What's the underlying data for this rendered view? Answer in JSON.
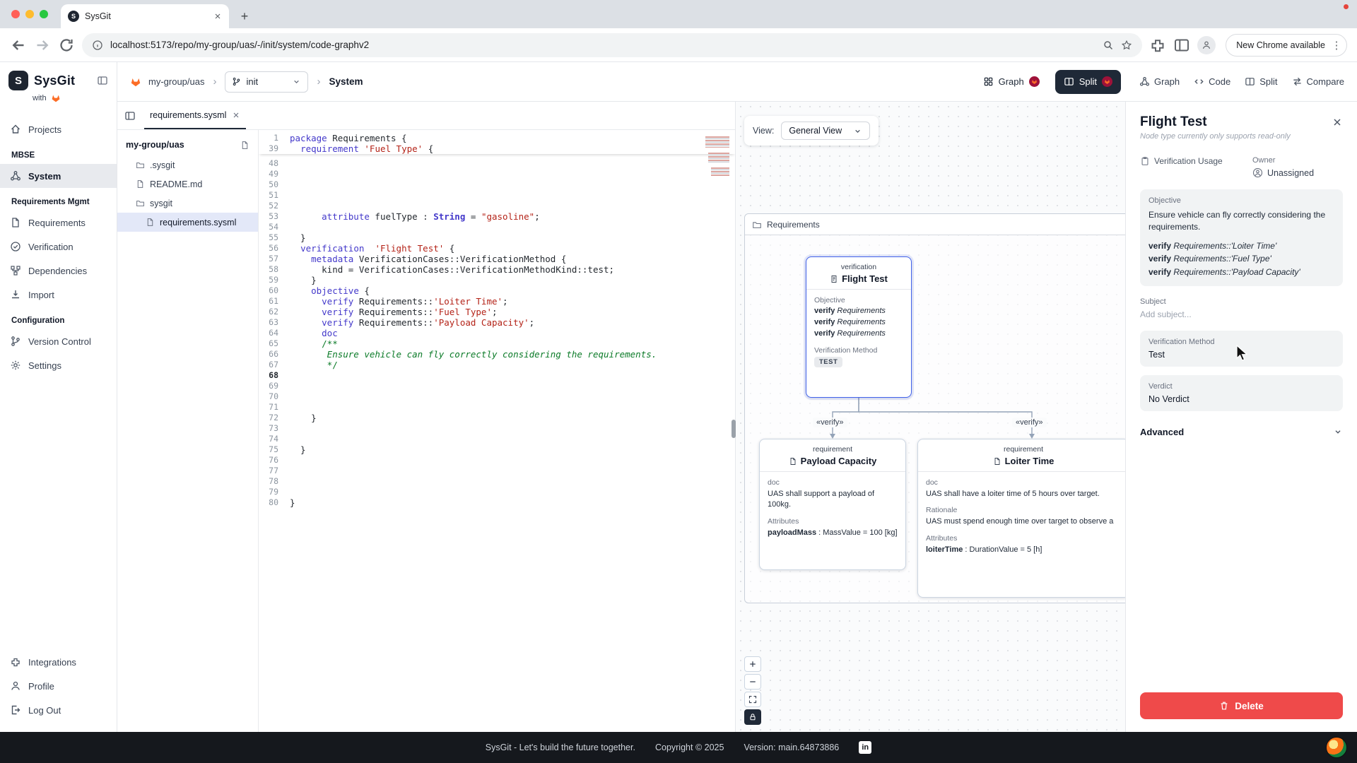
{
  "browser": {
    "tab_title": "SysGit",
    "url": "localhost:5173/repo/my-group/uas/-/init/system/code-graphv2",
    "update_label": "New Chrome available"
  },
  "sidebar": {
    "brand": "SysGit",
    "brand_letter": "S",
    "with_label": "with",
    "groups": [
      {
        "items": [
          {
            "label": "Projects",
            "icon": "home"
          }
        ]
      },
      {
        "header": "MBSE",
        "items": [
          {
            "label": "System",
            "icon": "system",
            "active": true
          }
        ]
      },
      {
        "header": "Requirements Mgmt",
        "items": [
          {
            "label": "Requirements",
            "icon": "doc"
          },
          {
            "label": "Verification",
            "icon": "check"
          },
          {
            "label": "Dependencies",
            "icon": "deps"
          },
          {
            "label": "Import",
            "icon": "import"
          }
        ]
      },
      {
        "header": "Configuration",
        "items": [
          {
            "label": "Version Control",
            "icon": "branch"
          },
          {
            "label": "Settings",
            "icon": "gear"
          }
        ]
      }
    ],
    "bottom": [
      {
        "label": "Integrations",
        "icon": "puzzle"
      },
      {
        "label": "Profile",
        "icon": "person"
      },
      {
        "label": "Log Out",
        "icon": "logout"
      }
    ]
  },
  "header": {
    "repo": "my-group/uas",
    "branch": "init",
    "page": "System",
    "primary_buttons": [
      {
        "label": "Graph",
        "icon": "grid",
        "active": false
      },
      {
        "label": "Split",
        "icon": "splitic",
        "active": true
      }
    ],
    "secondary_buttons": [
      {
        "label": "Graph",
        "icon": "system"
      },
      {
        "label": "Code",
        "icon": "code"
      },
      {
        "label": "Split",
        "icon": "splitic"
      },
      {
        "label": "Compare",
        "icon": "compare"
      }
    ]
  },
  "explorer": {
    "tab_label": "requirements.sysml",
    "root_label": "my-group/uas",
    "items": [
      {
        "label": ".sysgit",
        "icon": "folder",
        "indent": 0
      },
      {
        "label": "README.md",
        "icon": "file",
        "indent": 0
      },
      {
        "label": "sysgit",
        "icon": "folder",
        "indent": 0
      },
      {
        "label": "requirements.sysml",
        "icon": "file",
        "indent": 1,
        "active": true
      }
    ]
  },
  "editor": {
    "sticky": [
      {
        "n": "1",
        "t": [
          [
            "k",
            "package"
          ],
          [
            "d",
            " Requirements {"
          ]
        ]
      },
      {
        "n": "39",
        "t": [
          [
            "d",
            "  "
          ],
          [
            "k",
            "requirement"
          ],
          [
            "d",
            " "
          ],
          [
            "s",
            "'Fuel Type'"
          ],
          [
            "d",
            " {"
          ]
        ]
      }
    ],
    "lines": [
      {
        "n": "48",
        "t": []
      },
      {
        "n": "49",
        "t": []
      },
      {
        "n": "50",
        "t": []
      },
      {
        "n": "51",
        "t": []
      },
      {
        "n": "52",
        "t": []
      },
      {
        "n": "53",
        "t": [
          [
            "d",
            "      "
          ],
          [
            "k",
            "attribute"
          ],
          [
            "d",
            " fuelType : "
          ],
          [
            "t",
            "String"
          ],
          [
            "d",
            " = "
          ],
          [
            "s",
            "\"gasoline\""
          ],
          [
            "d",
            ";"
          ]
        ]
      },
      {
        "n": "54",
        "t": []
      },
      {
        "n": "55",
        "t": [
          [
            "d",
            "  }"
          ]
        ]
      },
      {
        "n": "56",
        "t": [
          [
            "d",
            "  "
          ],
          [
            "k",
            "verification"
          ],
          [
            "d",
            "  "
          ],
          [
            "s",
            "'Flight Test'"
          ],
          [
            "d",
            " {"
          ]
        ]
      },
      {
        "n": "57",
        "t": [
          [
            "d",
            "    "
          ],
          [
            "k",
            "metadata"
          ],
          [
            "d",
            " VerificationCases::VerificationMethod {"
          ]
        ]
      },
      {
        "n": "58",
        "t": [
          [
            "d",
            "      kind = VerificationCases::VerificationMethodKind::test;"
          ]
        ]
      },
      {
        "n": "59",
        "t": [
          [
            "d",
            "    }"
          ]
        ]
      },
      {
        "n": "60",
        "t": [
          [
            "d",
            "    "
          ],
          [
            "k",
            "objective"
          ],
          [
            "d",
            " {"
          ]
        ]
      },
      {
        "n": "61",
        "t": [
          [
            "d",
            "      "
          ],
          [
            "k",
            "verify"
          ],
          [
            "d",
            " Requirements::"
          ],
          [
            "s",
            "'Loiter Time'"
          ],
          [
            "d",
            ";"
          ]
        ]
      },
      {
        "n": "62",
        "t": [
          [
            "d",
            "      "
          ],
          [
            "k",
            "verify"
          ],
          [
            "d",
            " Requirements::"
          ],
          [
            "s",
            "'Fuel Type'"
          ],
          [
            "d",
            ";"
          ]
        ]
      },
      {
        "n": "63",
        "t": [
          [
            "d",
            "      "
          ],
          [
            "k",
            "verify"
          ],
          [
            "d",
            " Requirements::"
          ],
          [
            "s",
            "'Payload Capacity'"
          ],
          [
            "d",
            ";"
          ]
        ]
      },
      {
        "n": "64",
        "t": [
          [
            "d",
            "      "
          ],
          [
            "k",
            "doc"
          ]
        ]
      },
      {
        "n": "65",
        "t": [
          [
            "d",
            "      "
          ],
          [
            "c",
            "/**"
          ]
        ]
      },
      {
        "n": "66",
        "t": [
          [
            "ci",
            "       Ensure vehicle can fly correctly considering the requirements."
          ]
        ]
      },
      {
        "n": "67",
        "t": [
          [
            "c",
            "       */"
          ]
        ]
      },
      {
        "n": "68",
        "t": [],
        "active": true
      },
      {
        "n": "69",
        "t": []
      },
      {
        "n": "70",
        "t": []
      },
      {
        "n": "71",
        "t": []
      },
      {
        "n": "72",
        "t": [
          [
            "d",
            "    }"
          ]
        ]
      },
      {
        "n": "73",
        "t": []
      },
      {
        "n": "74",
        "t": []
      },
      {
        "n": "75",
        "t": [
          [
            "d",
            "  }"
          ]
        ]
      },
      {
        "n": "76",
        "t": []
      },
      {
        "n": "77",
        "t": []
      },
      {
        "n": "78",
        "t": []
      },
      {
        "n": "79",
        "t": []
      },
      {
        "n": "80",
        "t": [
          [
            "d",
            "}"
          ]
        ]
      }
    ]
  },
  "graph": {
    "view_label": "View:",
    "view_value": "General View",
    "container_title": "Requirements",
    "edge_label": "«verify»",
    "flight": {
      "stereotype": "verification",
      "title": "Flight Test",
      "objective_label": "Objective",
      "verify_word": "verify",
      "objective_rows": [
        "Requirements",
        "Requirements",
        "Requirements"
      ],
      "method_label": "Verification Method",
      "method_badge": "TEST"
    },
    "payload": {
      "stereotype": "requirement",
      "title": "Payload Capacity",
      "doc_label": "doc",
      "doc_text": "UAS shall support a payload of 100kg.",
      "attributes_label": "Attributes",
      "attribute_name": "payloadMass",
      "attribute_rest": " : MassValue = 100 [kg]"
    },
    "loiter": {
      "stereotype": "requirement",
      "title": "Loiter Time",
      "doc_label": "doc",
      "doc_text": "UAS shall have a loiter time of 5 hours over target.",
      "rationale_label": "Rationale",
      "rationale_text": "UAS must spend enough time over target to observe a",
      "attributes_label": "Attributes",
      "attribute_name": "loiterTime",
      "attribute_rest": " : DurationValue = 5 [h]"
    },
    "zoom_buttons": [
      {
        "icon": "plus"
      },
      {
        "icon": "minus"
      },
      {
        "icon": "fit"
      },
      {
        "icon": "lock",
        "dark": true
      }
    ]
  },
  "details": {
    "title": "Flight Test",
    "readonly_note": "Node type currently only supports read-only",
    "usage_label": "Verification Usage",
    "owner_label": "Owner",
    "owner_value": "Unassigned",
    "objective_label": "Objective",
    "objective_text": "Ensure vehicle can fly correctly considering the requirements.",
    "verify_word": "verify",
    "verifies": [
      "Requirements::'Loiter Time'",
      "Requirements::'Fuel Type'",
      "Requirements::'Payload Capacity'"
    ],
    "subject_label": "Subject",
    "subject_placeholder": "Add subject...",
    "method_label": "Verification Method",
    "method_value": "Test",
    "verdict_label": "Verdict",
    "verdict_value": "No Verdict",
    "advanced_label": "Advanced",
    "delete_label": "Delete"
  },
  "footer": {
    "tagline": "SysGit - Let's build the future together.",
    "copyright": "Copyright © 2025",
    "version": "Version: main.64873886"
  }
}
